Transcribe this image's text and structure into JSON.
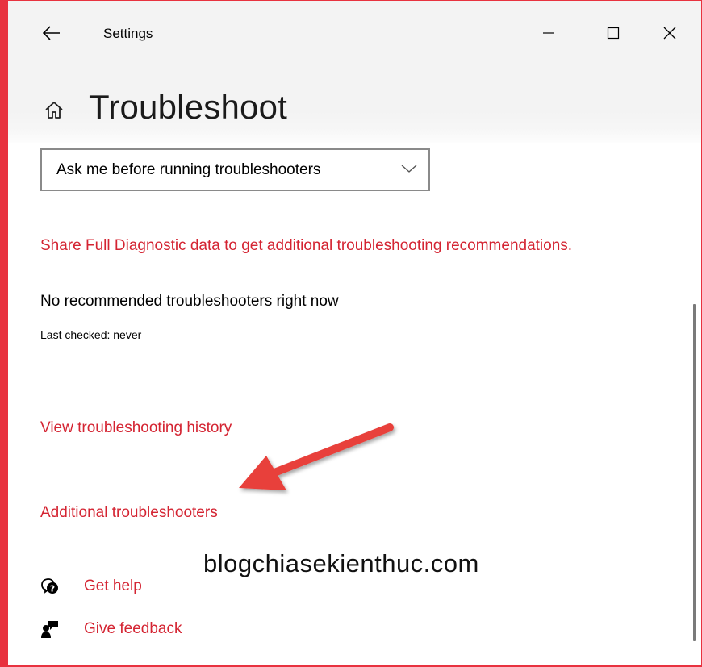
{
  "window": {
    "app_title": "Settings",
    "controls": {
      "minimize": "minimize-icon",
      "maximize": "maximize-icon",
      "close": "close-icon"
    }
  },
  "header": {
    "home_icon": "home-icon",
    "title": "Troubleshoot"
  },
  "dropdown": {
    "selected": "Ask me before running troubleshooters"
  },
  "content": {
    "share_link": "Share Full Diagnostic data to get additional troubleshooting recommendations.",
    "no_recommended": "No recommended troubleshooters right now",
    "last_checked": "Last checked: never",
    "history_link": "View troubleshooting history",
    "additional_link": "Additional troubleshooters"
  },
  "annotation": {
    "watermark": "blogchiasekienthuc.com",
    "arrow_color": "#e8403a"
  },
  "help": {
    "get_help": "Get help",
    "give_feedback": "Give feedback"
  },
  "colors": {
    "accent_red": "#d42432",
    "border_red": "#e8323f",
    "header_bg": "#f3f3f3"
  }
}
